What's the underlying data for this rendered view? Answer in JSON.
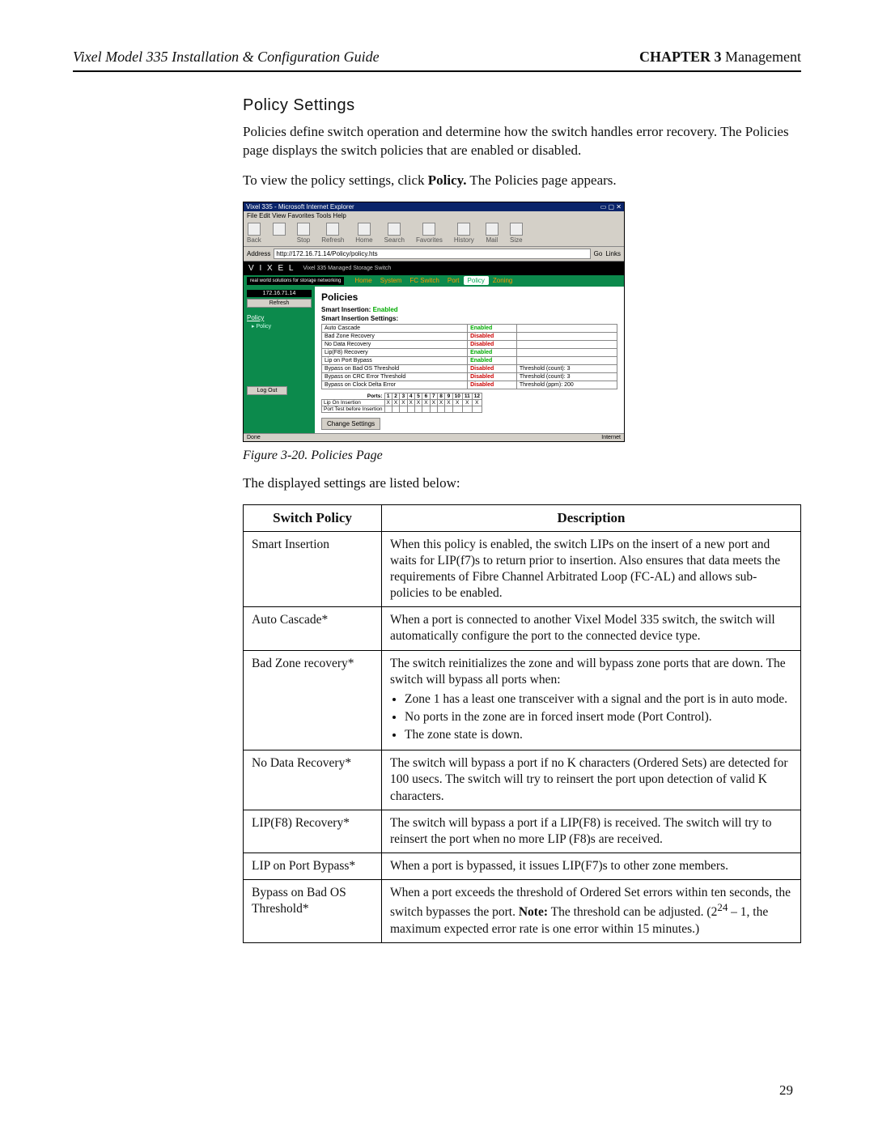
{
  "header": {
    "left": "Vixel Model 335 Installation & Configuration Guide",
    "chapter_label": "CHAPTER 3",
    "chapter_name": " Management"
  },
  "section": {
    "title": "Policy Settings",
    "para1": "Policies define switch operation and determine how the switch handles error recovery. The Policies page displays the switch policies that are enabled or disabled.",
    "para2_prefix": "To view the policy settings, click ",
    "para2_bold": "Policy.",
    "para2_suffix": " The Policies page appears.",
    "figure_caption": "Figure 3-20. Policies Page",
    "listed_below": "The displayed settings are listed below:"
  },
  "screenshot": {
    "titlebar": "Vixel 335 - Microsoft Internet Explorer",
    "menu": "File   Edit   View   Favorites   Tools   Help",
    "toolbar": [
      "Back",
      "",
      "Stop",
      "Refresh",
      "Home",
      "Search",
      "Favorites",
      "History",
      "Mail",
      "Size"
    ],
    "addr_label": "Address",
    "addr_value": "http://172.16.71.14/Policy/policy.hts",
    "go": "Go",
    "links": "Links",
    "brand": "V I X E L",
    "brand_sub": "Vixel 335 Managed Storage Switch",
    "tagline": "real world solutions for storage networking",
    "tabs": [
      "Home",
      "System",
      "FC Switch",
      "Port",
      "Policy",
      "Zoning"
    ],
    "ip": "172.16.71.14",
    "refresh": "Refresh",
    "side_menu": "Policy",
    "side_item": "Policy",
    "logout": "Log Out",
    "page_heading": "Policies",
    "smart_insertion_label": "Smart Insertion:",
    "smart_insertion_val": "Enabled",
    "sis_heading": "Smart Insertion Settings:",
    "rows": [
      {
        "n": "Auto Cascade",
        "s": "Enabled",
        "x": ""
      },
      {
        "n": "Bad Zone Recovery",
        "s": "Disabled",
        "x": ""
      },
      {
        "n": "No Data Recovery",
        "s": "Disabled",
        "x": ""
      },
      {
        "n": "Lip(F8) Recovery",
        "s": "Enabled",
        "x": ""
      },
      {
        "n": "Lip on Port Bypass",
        "s": "Enabled",
        "x": ""
      },
      {
        "n": "Bypass on Bad OS Threshold",
        "s": "Disabled",
        "x": "Threshold (count): 3"
      },
      {
        "n": "Bypass on CRC Error Threshold",
        "s": "Disabled",
        "x": "Threshold (count): 3"
      },
      {
        "n": "Bypass on Clock Delta Error",
        "s": "Disabled",
        "x": "Threshold (ppm): 200"
      }
    ],
    "ports_label": "Ports:",
    "port_rows": [
      "Lip On Insertion",
      "Port Test before Insertion"
    ],
    "change_settings": "Change Settings",
    "status_left": "Done",
    "status_right": "Internet"
  },
  "policy_table": {
    "headers": [
      "Switch Policy",
      "Description"
    ],
    "rows": [
      {
        "name": "Smart Insertion",
        "desc": "When this policy is enabled, the switch LIPs on the insert of a new port and waits for LIP(f7)s to return prior to insertion. Also ensures that data meets the requirements of Fibre Channel Arbitrated Loop (FC-AL) and allows sub-policies to be enabled."
      },
      {
        "name": "Auto Cascade*",
        "desc": "When a port is connected to another Vixel Model 335 switch, the switch will automatically configure the port to the connected device type."
      },
      {
        "name": "Bad Zone recovery*",
        "desc": "The switch reinitializes the zone and will bypass zone ports that are down. The switch will bypass all ports when:",
        "bullets": [
          "Zone 1 has a least one transceiver with a signal and the port is in auto mode.",
          "No ports in the zone are in forced insert mode (Port Control).",
          "The zone state is down."
        ]
      },
      {
        "name": "No Data Recovery*",
        "desc": "The switch will bypass a port if no K characters (Ordered Sets) are detected for 100 usecs. The switch will try to reinsert the port upon detection of valid K characters."
      },
      {
        "name": "LIP(F8) Recovery*",
        "desc": "The switch will bypass a port if a LIP(F8) is received. The switch will try to reinsert the port when no more LIP (F8)s are received."
      },
      {
        "name": "LIP on Port Bypass*",
        "desc": "When a port is bypassed, it issues LIP(F7)s to other zone members."
      },
      {
        "name": "Bypass on Bad OS Threshold*",
        "desc_html": "When a port exceeds the threshold of Ordered Set errors within ten seconds, the switch bypasses the port. <b>Note:</b> The threshold can be adjusted. (2<sup>24</sup> – 1, the maximum expected error rate is one error within 15 minutes.)"
      }
    ]
  },
  "page_number": "29"
}
